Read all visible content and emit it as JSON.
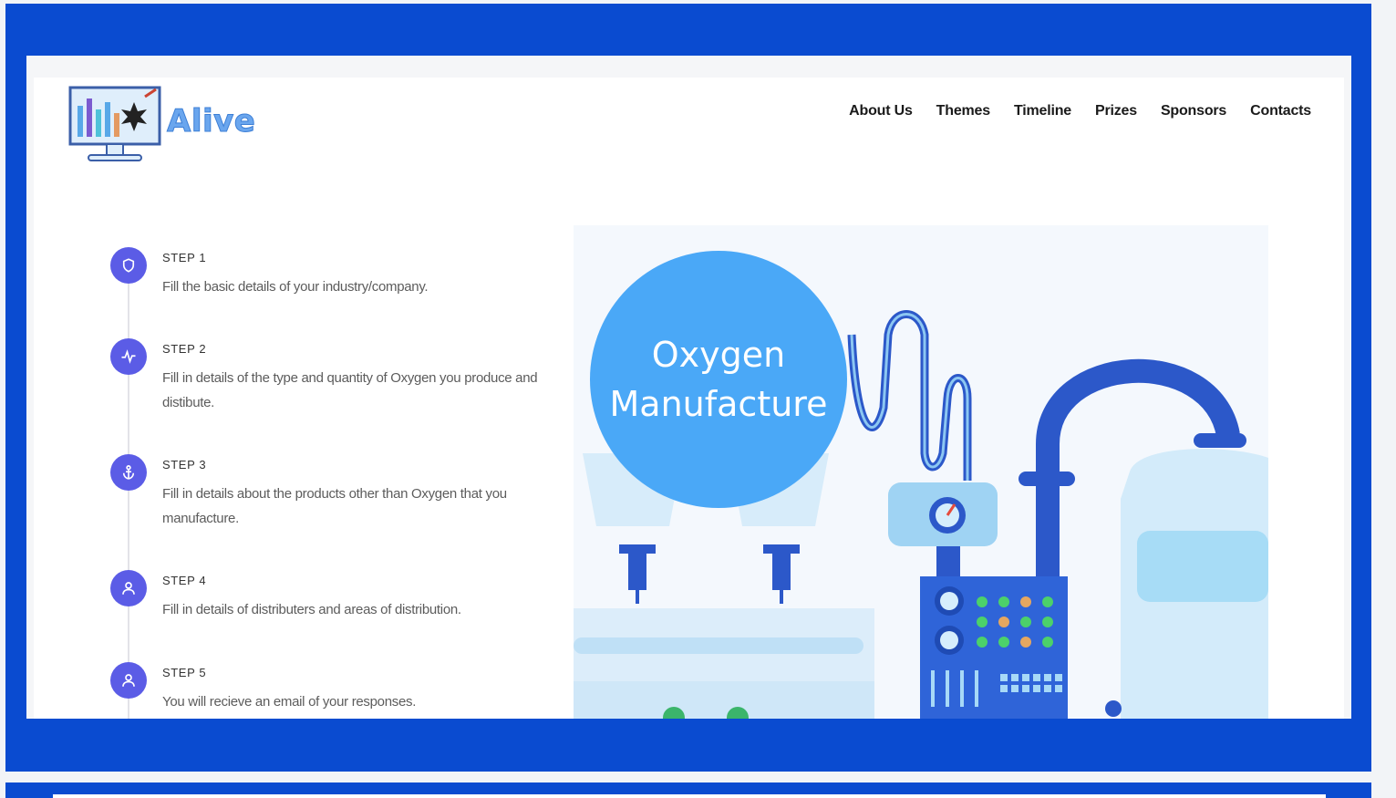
{
  "brand": {
    "name": "Alive"
  },
  "nav": {
    "items": [
      "About Us",
      "Themes",
      "Timeline",
      "Prizes",
      "Sponsors",
      "Contacts"
    ]
  },
  "steps": [
    {
      "title": "STEP 1",
      "description": "Fill the basic details of your industry/company.",
      "icon": "shield-icon"
    },
    {
      "title": "STEP 2",
      "description": "Fill in details of the type and quantity of Oxygen you produce and distibute.",
      "icon": "activity-icon"
    },
    {
      "title": "STEP 3",
      "description": "Fill in details about the products other than Oxygen that you manufacture.",
      "icon": "anchor-icon"
    },
    {
      "title": "STEP 4",
      "description": "Fill in details of distributers and areas of distribution.",
      "icon": "user-icon"
    },
    {
      "title": "STEP 5",
      "description": "You will recieve an email of your responses.",
      "icon": "user-icon"
    }
  ],
  "illustration": {
    "title_line1": "Oxygen",
    "title_line2": "Manufacture"
  },
  "colors": {
    "frame": "#0a4bd0",
    "accent": "#5b5ce6",
    "bubble": "#4aa8f7",
    "logo_text": "#6aa6ee"
  }
}
